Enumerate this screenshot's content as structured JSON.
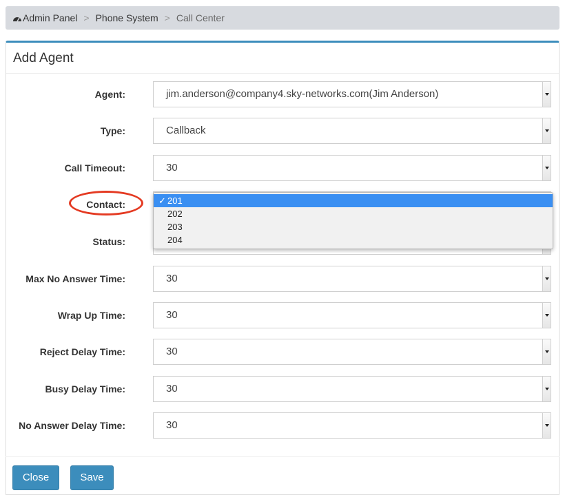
{
  "breadcrumb": {
    "icon": "dashboard-icon",
    "items": [
      "Admin Panel",
      "Phone System",
      "Call Center"
    ],
    "separator": ">"
  },
  "panel": {
    "title": "Add Agent"
  },
  "form": {
    "agent": {
      "label": "Agent:",
      "value": "jim.anderson@company4.sky-networks.com(Jim Anderson)"
    },
    "type": {
      "label": "Type:",
      "value": "Callback"
    },
    "call_timeout": {
      "label": "Call Timeout:",
      "value": "30"
    },
    "contact": {
      "label": "Contact:",
      "value": "201",
      "options": [
        "201",
        "202",
        "203",
        "204"
      ],
      "selected_index": 0
    },
    "status": {
      "label": "Status:",
      "value": ""
    },
    "max_no_answer_time": {
      "label": "Max No Answer Time:",
      "value": "30"
    },
    "wrap_up_time": {
      "label": "Wrap Up Time:",
      "value": "30"
    },
    "reject_delay_time": {
      "label": "Reject Delay Time:",
      "value": "30"
    },
    "busy_delay_time": {
      "label": "Busy Delay Time:",
      "value": "30"
    },
    "no_answer_delay_time": {
      "label": "No Answer Delay Time:",
      "value": "30"
    }
  },
  "buttons": {
    "close": "Close",
    "save": "Save"
  },
  "checkmark": "✓",
  "colors": {
    "primary": "#3c8dbc",
    "highlight_ring": "#e43a22",
    "selected_option": "#3a8ff2"
  }
}
